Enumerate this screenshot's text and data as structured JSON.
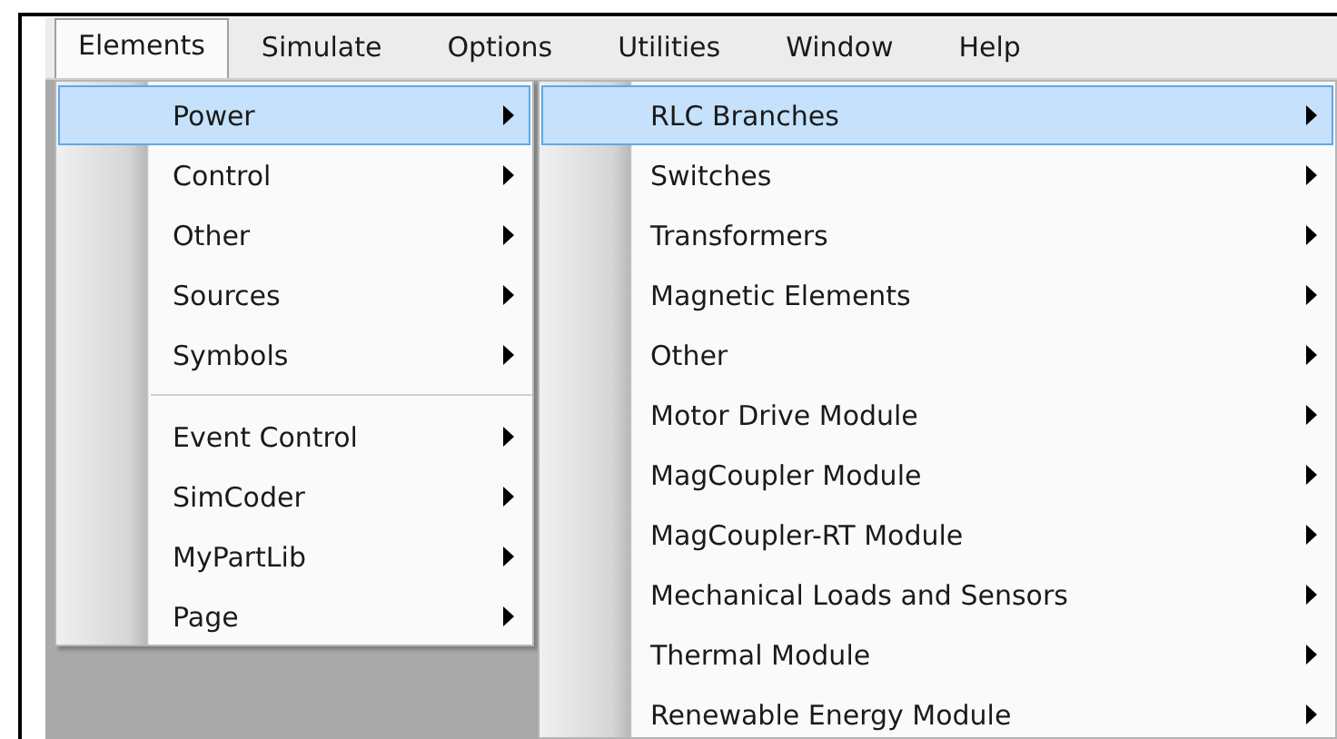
{
  "menu_bar": [
    {
      "label": "Elements",
      "selected": true
    },
    {
      "label": "Simulate",
      "selected": false
    },
    {
      "label": "Options",
      "selected": false
    },
    {
      "label": "Utilities",
      "selected": false
    },
    {
      "label": "Window",
      "selected": false
    },
    {
      "label": "Help",
      "selected": false
    }
  ],
  "elements_menu": [
    {
      "kind": "item",
      "label": "Power",
      "selected": true,
      "submenu": true
    },
    {
      "kind": "item",
      "label": "Control",
      "selected": false,
      "submenu": true
    },
    {
      "kind": "item",
      "label": "Other",
      "selected": false,
      "submenu": true
    },
    {
      "kind": "item",
      "label": "Sources",
      "selected": false,
      "submenu": true
    },
    {
      "kind": "item",
      "label": "Symbols",
      "selected": false,
      "submenu": true
    },
    {
      "kind": "separator"
    },
    {
      "kind": "item",
      "label": "Event Control",
      "selected": false,
      "submenu": true
    },
    {
      "kind": "item",
      "label": "SimCoder",
      "selected": false,
      "submenu": true
    },
    {
      "kind": "item",
      "label": "MyPartLib",
      "selected": false,
      "submenu": true
    },
    {
      "kind": "item",
      "label": "Page",
      "selected": false,
      "submenu": true
    }
  ],
  "power_submenu": [
    {
      "kind": "item",
      "label": "RLC Branches",
      "selected": true,
      "submenu": true
    },
    {
      "kind": "item",
      "label": "Switches",
      "selected": false,
      "submenu": true
    },
    {
      "kind": "item",
      "label": "Transformers",
      "selected": false,
      "submenu": true
    },
    {
      "kind": "item",
      "label": "Magnetic Elements",
      "selected": false,
      "submenu": true
    },
    {
      "kind": "item",
      "label": "Other",
      "selected": false,
      "submenu": true
    },
    {
      "kind": "item",
      "label": "Motor Drive Module",
      "selected": false,
      "submenu": true
    },
    {
      "kind": "item",
      "label": "MagCoupler Module",
      "selected": false,
      "submenu": true
    },
    {
      "kind": "item",
      "label": "MagCoupler-RT Module",
      "selected": false,
      "submenu": true
    },
    {
      "kind": "item",
      "label": "Mechanical Loads and Sensors",
      "selected": false,
      "submenu": true
    },
    {
      "kind": "item",
      "label": "Thermal Module",
      "selected": false,
      "submenu": true
    },
    {
      "kind": "item",
      "label": "Renewable Energy Module",
      "selected": false,
      "submenu": true
    }
  ]
}
